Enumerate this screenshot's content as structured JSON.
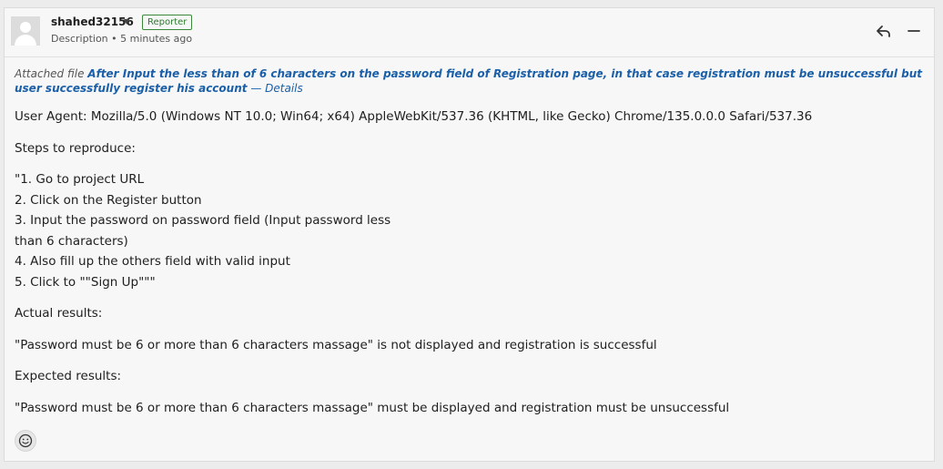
{
  "comment": {
    "author": "shahed32156",
    "role_badge": "Reporter",
    "meta": "Description • 5 minutes ago",
    "attached_prefix": "Attached file ",
    "attached_file": "After Input the less than of 6 characters on the password field of Registration page, in that case registration must be unsuccessful but user successfully register his account",
    "details_link": "— Details",
    "user_agent": "User Agent: Mozilla/5.0 (Windows NT 10.0; Win64; x64) AppleWebKit/537.36 (KHTML, like Gecko) Chrome/135.0.0.0 Safari/537.36",
    "steps_heading": "Steps to reproduce:",
    "steps": [
      "\"1. Go to project URL",
      "2. Click on the Register button",
      "3. Input the password on password field (Input password less",
      "than 6 characters)",
      "4. Also fill up the others field with valid input",
      "5. Click to \"\"Sign Up\"\"\""
    ],
    "actual_heading": "Actual results:",
    "actual_text": "\"Password must be 6 or more than 6 characters massage\" is not displayed and registration is successful",
    "expected_heading": "Expected results:",
    "expected_text": "\"Password must be 6 or more than 6 characters massage\" must be displayed and registration must be unsuccessful"
  },
  "icons": {
    "reply": "reply-icon",
    "collapse": "minus-icon",
    "emoji": "smiley-icon",
    "avatar": "default-avatar"
  },
  "colors": {
    "link": "#1a5fa8",
    "badge": "#2e7a2e"
  }
}
